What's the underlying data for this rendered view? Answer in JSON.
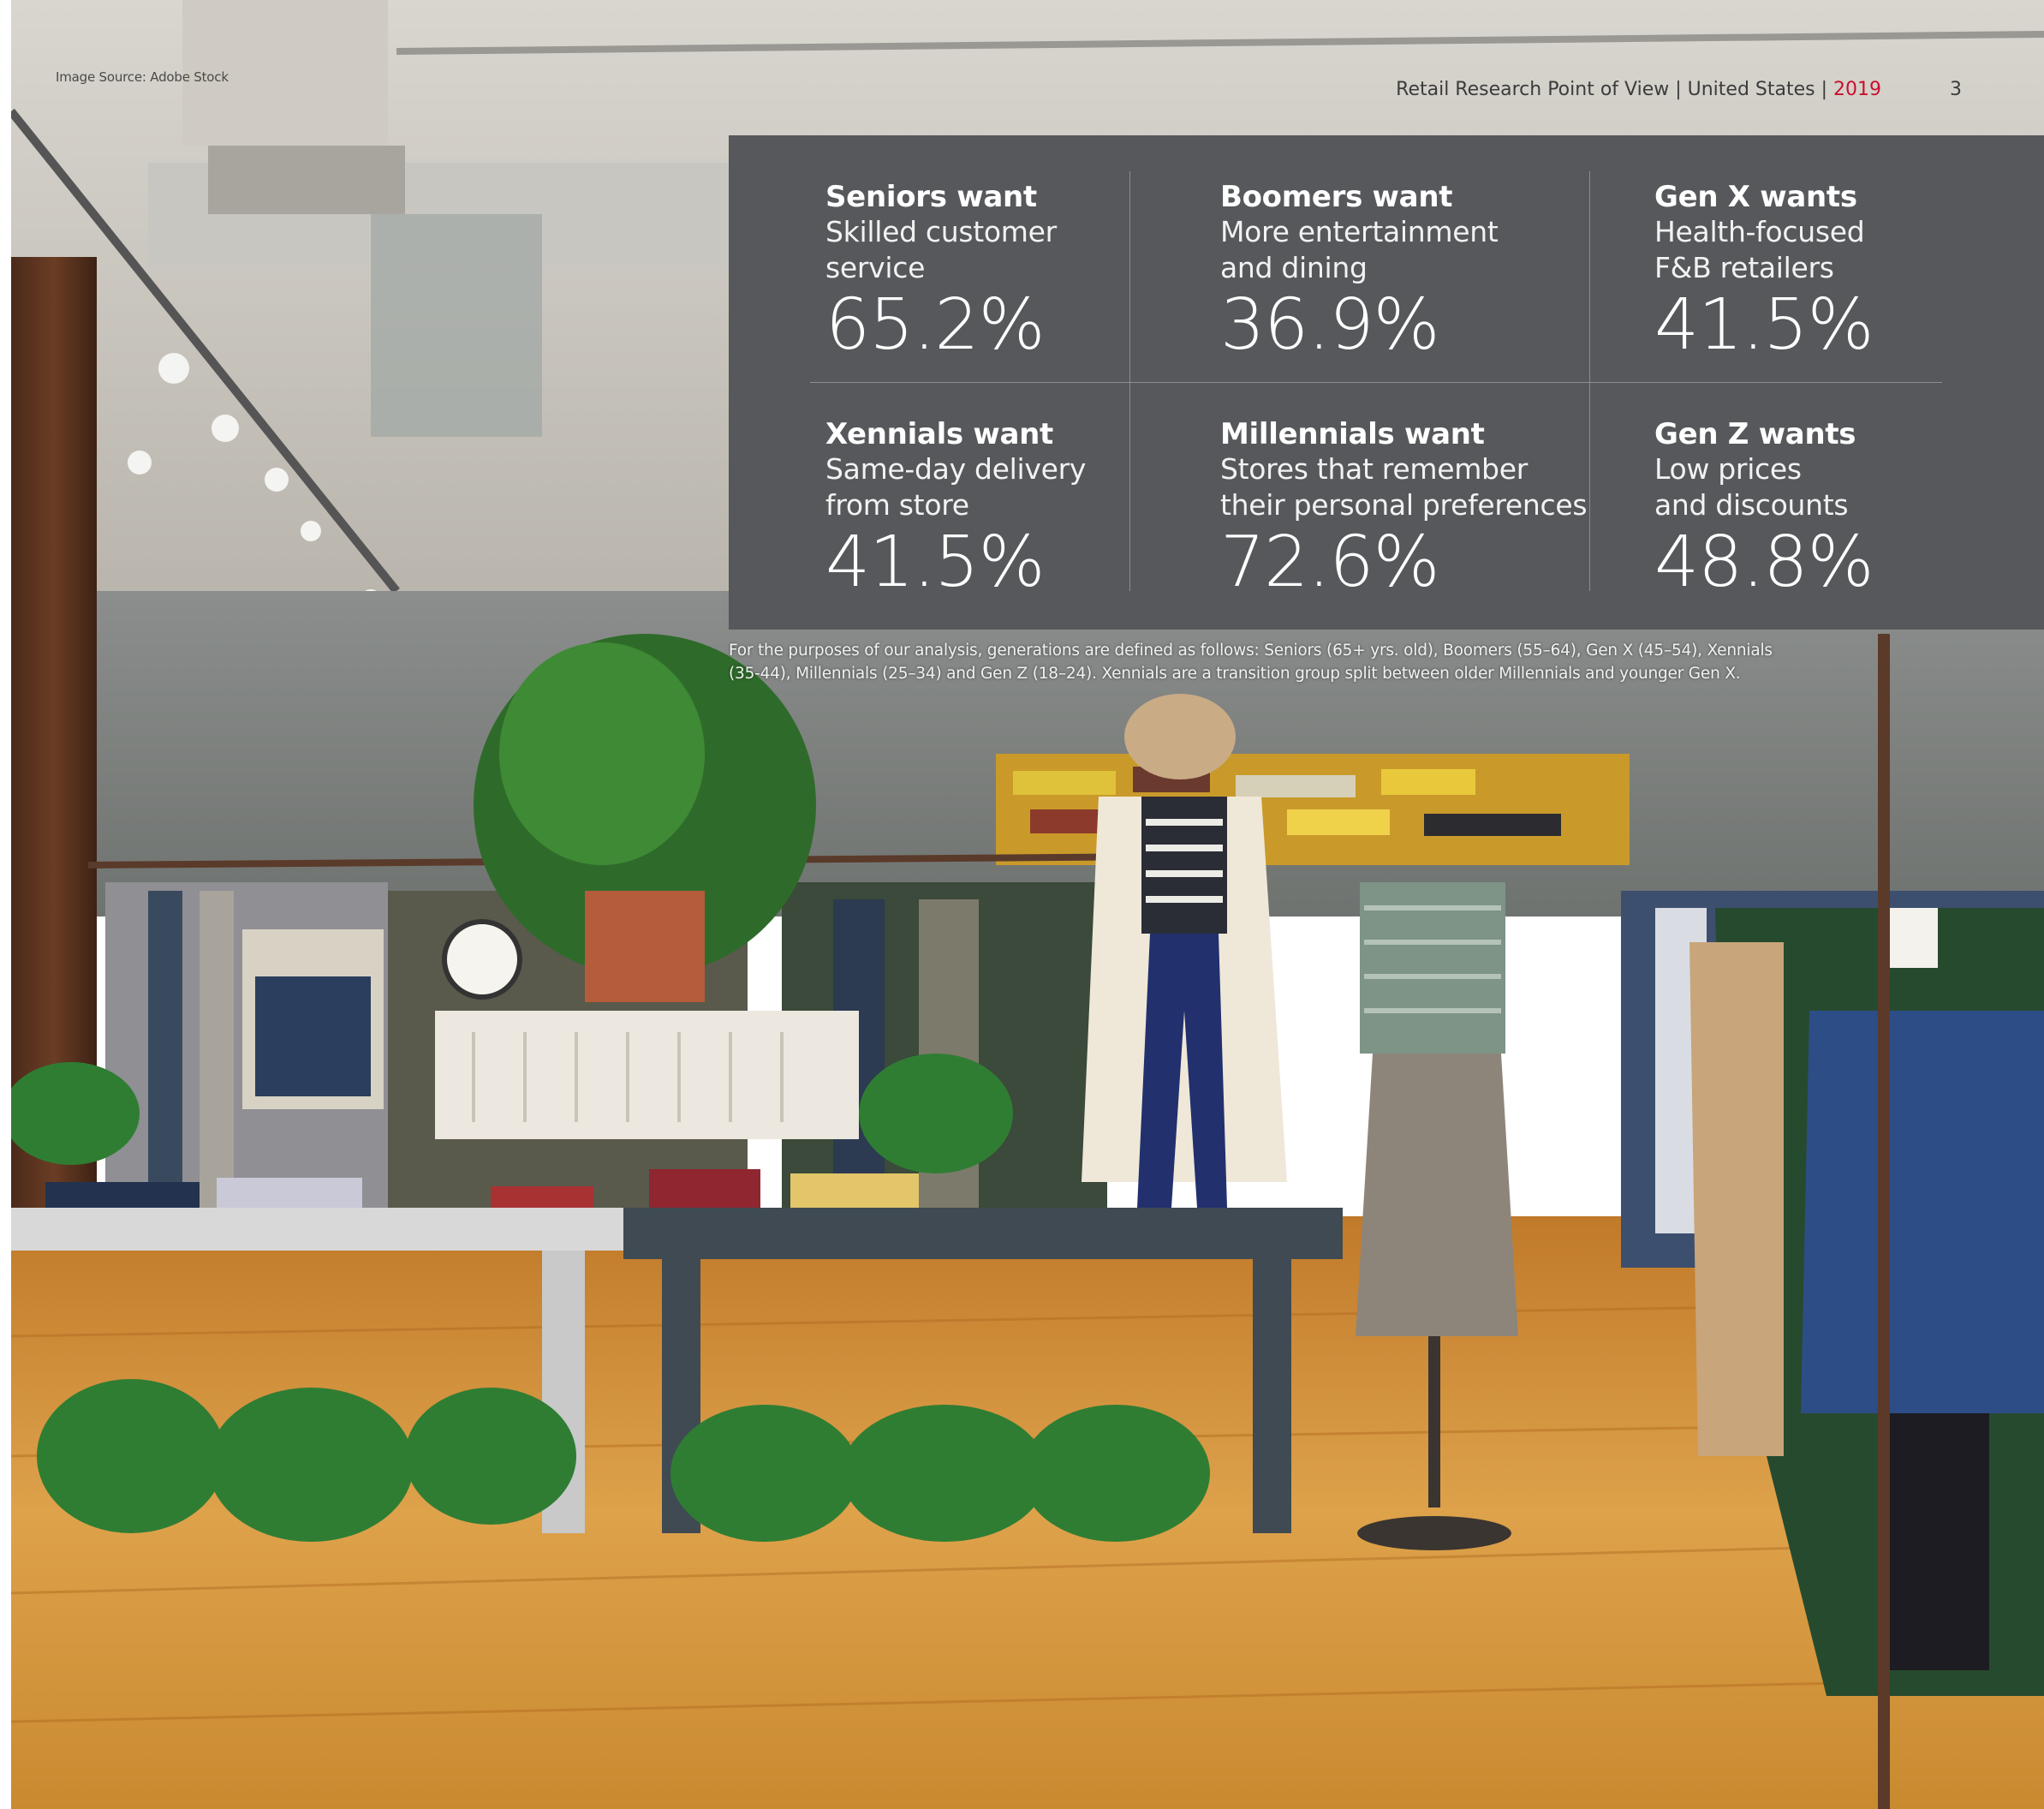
{
  "image_credit": "Image Source: Adobe Stock",
  "header": {
    "publication": "Retail Research Point of View | United States | ",
    "year": "2019",
    "page_number": "3"
  },
  "stats": [
    {
      "title": "Seniors want",
      "desc_line1": "Skilled customer",
      "desc_line2": "service",
      "value": "65.2%"
    },
    {
      "title": "Boomers want",
      "desc_line1": "More entertainment",
      "desc_line2": "and dining",
      "value": "36.9%"
    },
    {
      "title": "Gen X wants",
      "desc_line1": "Health-focused",
      "desc_line2": "F&B retailers",
      "value": "41.5%"
    },
    {
      "title": "Xennials want",
      "desc_line1": "Same-day delivery",
      "desc_line2": "from store",
      "value": "41.5%"
    },
    {
      "title": "Millennials want",
      "desc_line1": "Stores that remember",
      "desc_line2": "their personal preferences",
      "value": "72.6%"
    },
    {
      "title": "Gen Z wants",
      "desc_line1": "Low prices",
      "desc_line2": "and discounts",
      "value": "48.8%"
    }
  ],
  "footnote": "For the purposes of our analysis, generations are defined as follows: Seniors (65+ yrs. old), Boomers (55–64), Gen X (45–54), Xennials (35-44), Millennials (25–34) and Gen Z (18–24). Xennials are a transition group split between older Millennials and younger Gen X.",
  "colors": {
    "panel": "#56585b",
    "accent_year": "#c8102e"
  }
}
